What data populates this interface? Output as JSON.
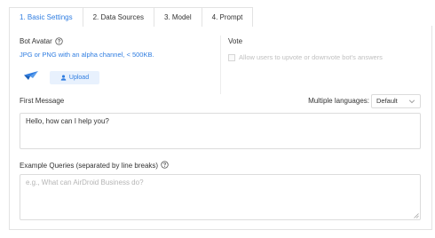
{
  "tabs": [
    {
      "label": "1. Basic Settings",
      "active": true
    },
    {
      "label": "2. Data Sources",
      "active": false
    },
    {
      "label": "3. Model",
      "active": false
    },
    {
      "label": "4. Prompt",
      "active": false
    }
  ],
  "avatar": {
    "label": "Bot Avatar",
    "hint": "JPG or PNG with an alpha channel, < 500KB.",
    "upload_label": "Upload",
    "icon": "paper-plane-icon"
  },
  "vote": {
    "label": "Vote",
    "checkbox_label": "Allow users to upvote or downvote bot's answers",
    "checked": false
  },
  "first_message": {
    "label": "First Message",
    "value": "Hello, how can I help you?"
  },
  "languages": {
    "label": "Multiple languages:",
    "selected": "Default"
  },
  "example_queries": {
    "label": "Example Queries (separated by line breaks)",
    "placeholder": "e.g., What can AirDroid Business do?",
    "value": ""
  },
  "colors": {
    "accent": "#2f7de1",
    "upload_bg": "#e8f1fd",
    "border": "#e3e3e3"
  }
}
